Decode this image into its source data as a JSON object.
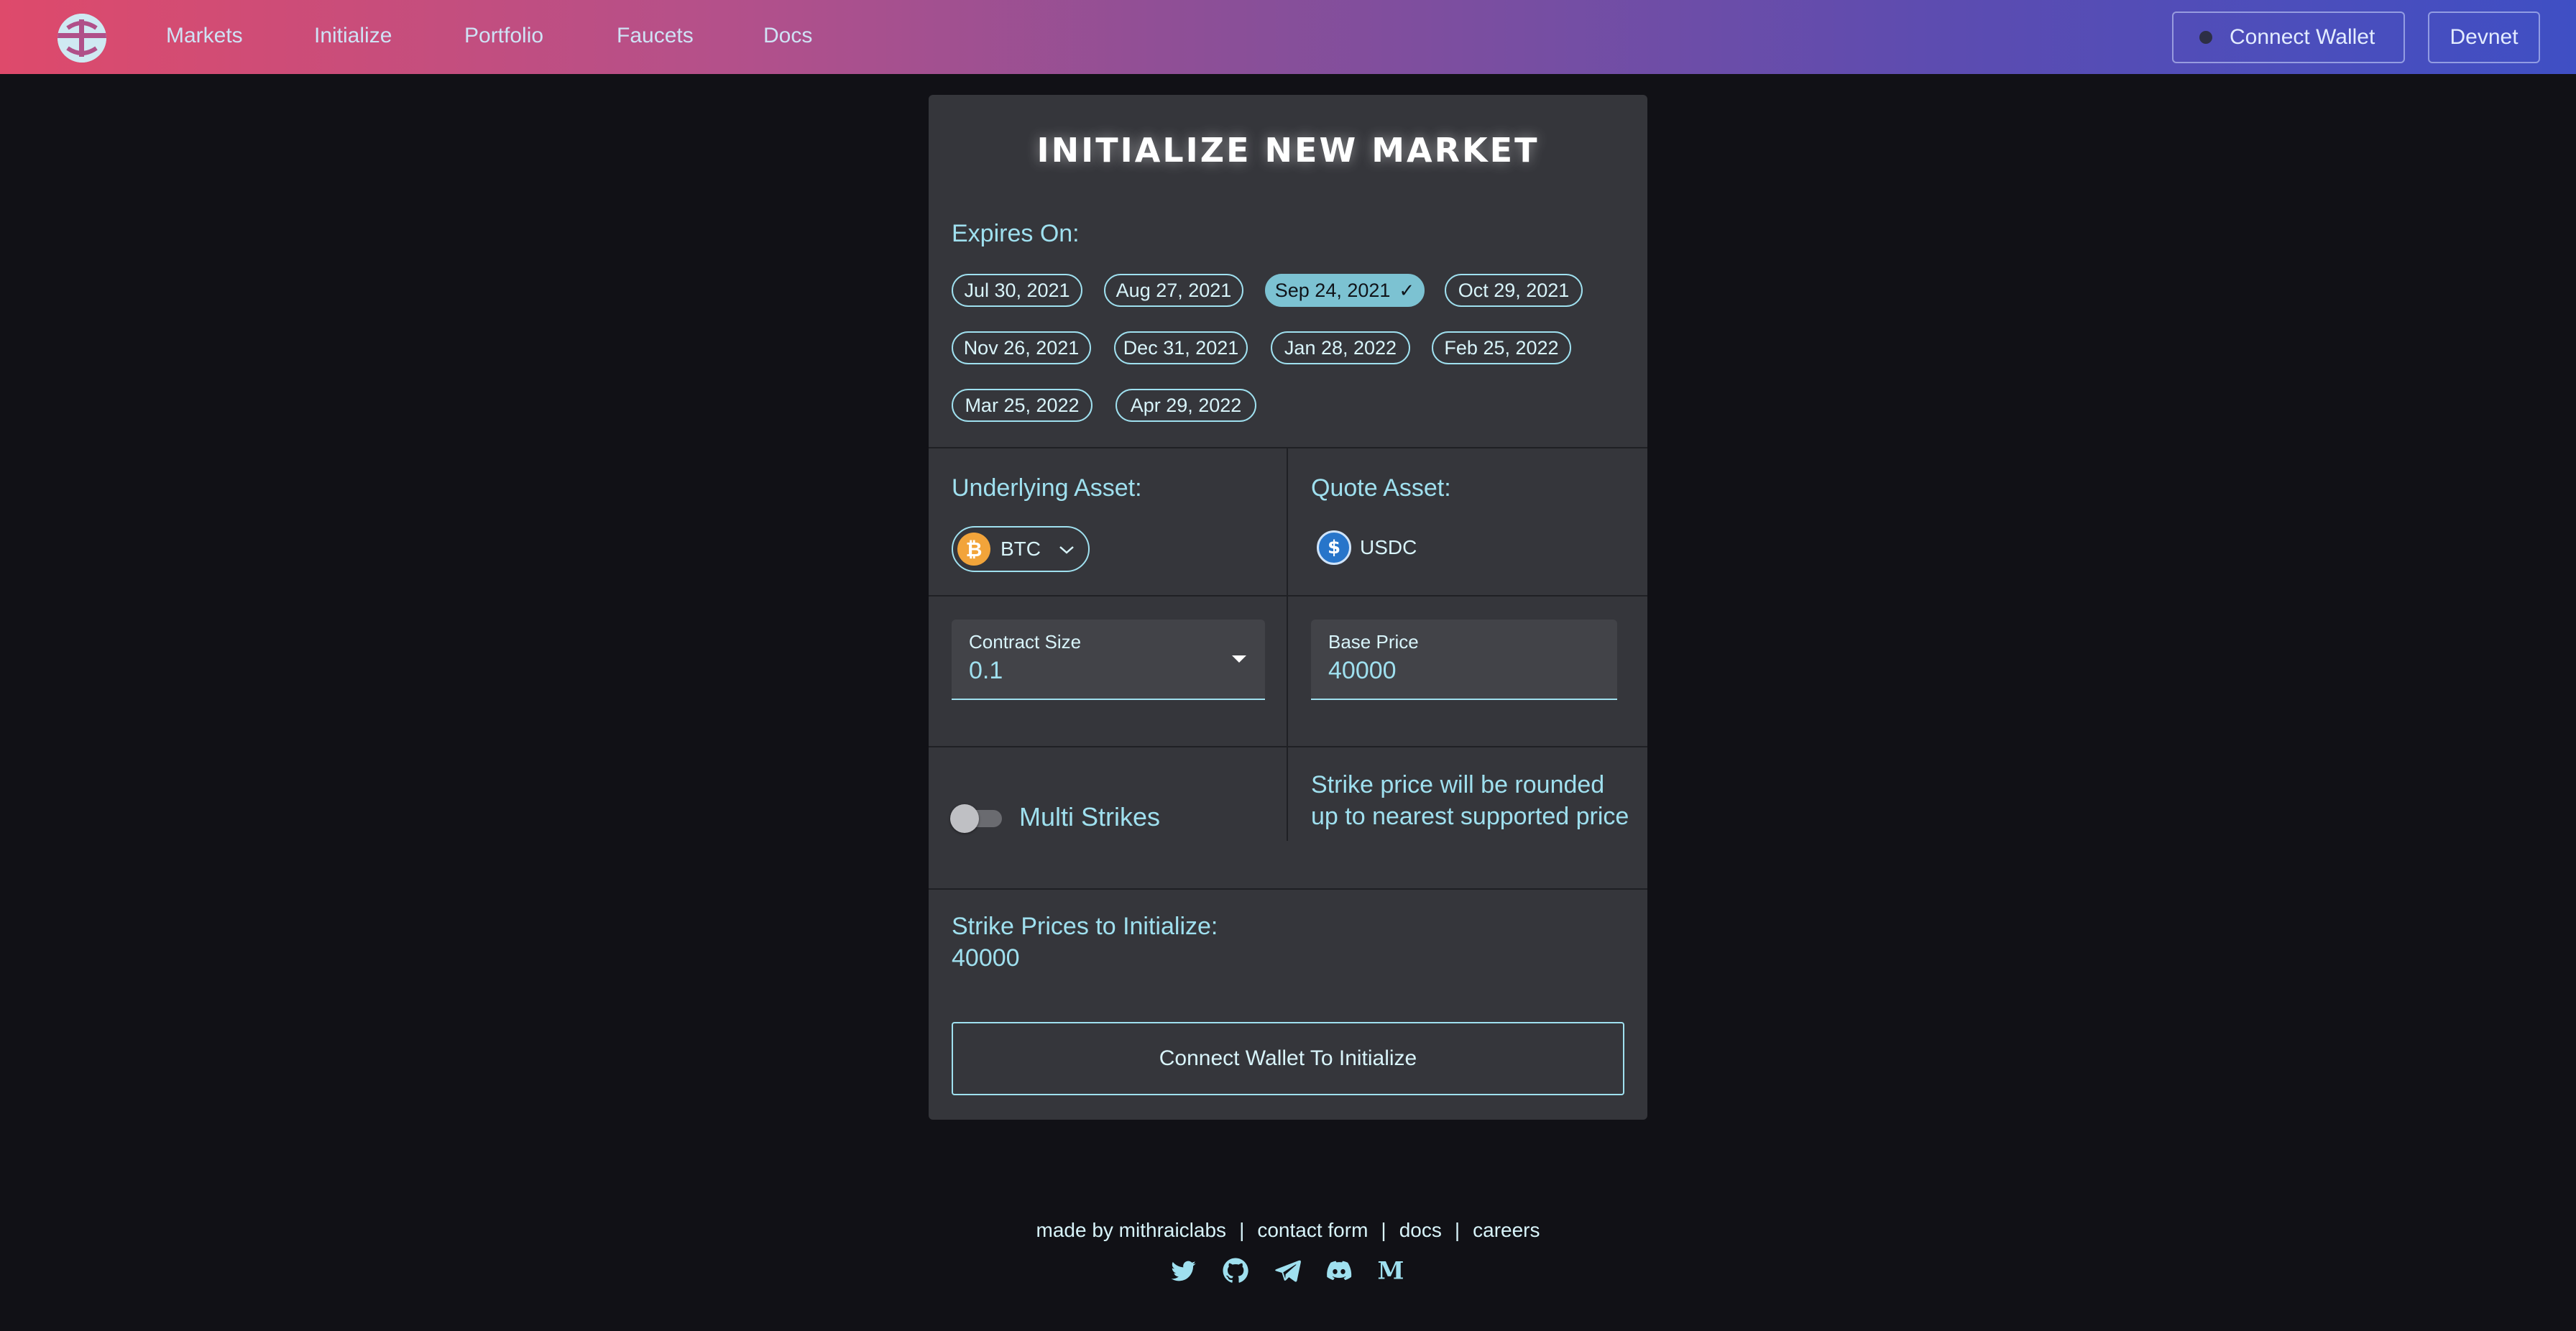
{
  "nav": {
    "items": [
      {
        "label": "Markets"
      },
      {
        "label": "Initialize"
      },
      {
        "label": "Portfolio"
      },
      {
        "label": "Faucets"
      },
      {
        "label": "Docs"
      }
    ],
    "connect_wallet": "Connect Wallet",
    "network": "Devnet"
  },
  "card": {
    "title": "INITIALIZE NEW MARKET",
    "expires_label": "Expires On:",
    "expiry_dates": [
      "Jul 30, 2021",
      "Aug 27, 2021",
      "Sep 24, 2021",
      "Oct 29, 2021",
      "Nov 26, 2021",
      "Dec 31, 2021",
      "Jan 28, 2022",
      "Feb 25, 2022",
      "Mar 25, 2022",
      "Apr 29, 2022"
    ],
    "selected_expiry": "Sep 24, 2021",
    "underlying_label": "Underlying Asset:",
    "underlying_asset": "BTC",
    "quote_label": "Quote Asset:",
    "quote_asset": "USDC",
    "contract_size": {
      "label": "Contract Size",
      "value": "0.1"
    },
    "base_price": {
      "label": "Base Price",
      "value": "40000"
    },
    "multi_strikes_label": "Multi Strikes",
    "multi_strikes_enabled": false,
    "strike_note": "Strike price will be rounded up to nearest supported price",
    "strike_prices_label": "Strike Prices to Initialize:",
    "strike_prices_value": "40000",
    "action_button": "Connect Wallet To Initialize"
  },
  "footer": {
    "made_by": "made by mithraiclabs",
    "separator": "|",
    "links": [
      "contact form",
      "docs",
      "careers"
    ],
    "socials": [
      "twitter-icon",
      "github-icon",
      "telegram-icon",
      "discord-icon",
      "medium-icon"
    ]
  },
  "colors": {
    "accent": "#9fe0ef",
    "selected_chip": "#7cc2d2",
    "card_bg": "#35363b",
    "page_bg": "#111116",
    "btc": "#f2a43a",
    "usdc": "#2775ca"
  }
}
